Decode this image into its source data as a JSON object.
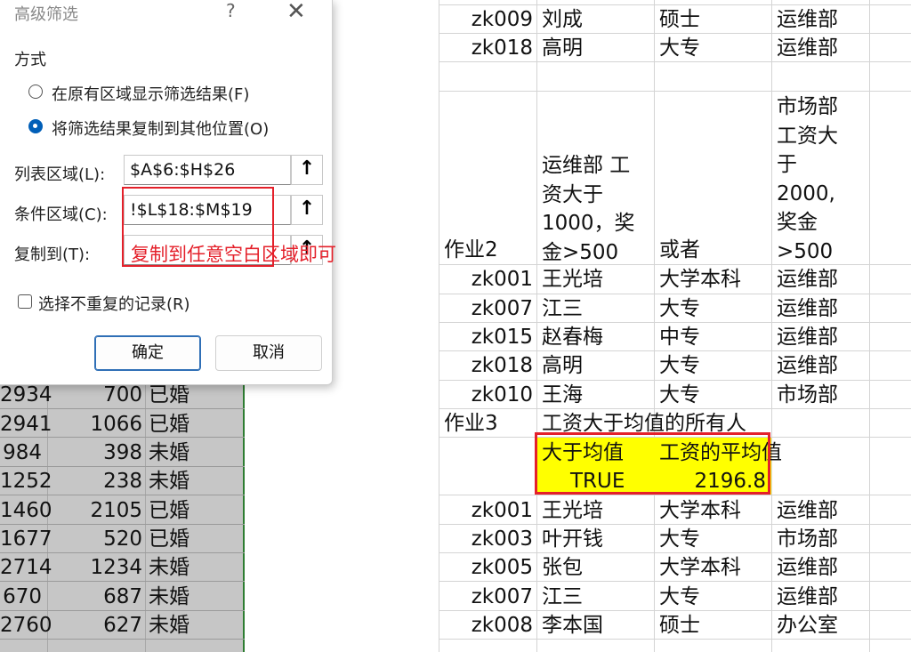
{
  "dialog": {
    "title": "高级筛选",
    "help": "?",
    "close": "✕",
    "method_label": "方式",
    "option_in_place": "在原有区域显示筛选结果(F)",
    "option_copy": "将筛选结果复制到其他位置(O)",
    "list_range_label": "列表区域(L):",
    "list_range_value": "$A$6:$H$26",
    "criteria_label": "条件区域(C):",
    "criteria_value": "!$L$18:$M$19",
    "copy_to_label": "复制到(T):",
    "copy_to_value": "",
    "unique_label": "选择不重复的记录(R)",
    "ok": "确定",
    "cancel": "取消",
    "selected_option": "copy",
    "annotation": "复制到任意空白区域即可"
  },
  "left_sheet": {
    "rows": [
      {
        "a": "2934",
        "b": "700",
        "c": "已婚"
      },
      {
        "a": "2941",
        "b": "1066",
        "c": "已婚"
      },
      {
        "a": "984",
        "b": "398",
        "c": "未婚"
      },
      {
        "a": "1252",
        "b": "238",
        "c": "未婚"
      },
      {
        "a": "1460",
        "b": "2105",
        "c": "已婚"
      },
      {
        "a": "1677",
        "b": "520",
        "c": "已婚"
      },
      {
        "a": "2714",
        "b": "1234",
        "c": "未婚"
      },
      {
        "a": "670",
        "b": "687",
        "c": "未婚"
      },
      {
        "a": "2760",
        "b": "627",
        "c": "未婚"
      }
    ]
  },
  "sheet": {
    "top_rows": [
      {
        "id": "zk009",
        "name": "刘成",
        "edu": "硕士",
        "dept": "运维部"
      },
      {
        "id": "zk018",
        "name": "高明",
        "edu": "大专",
        "dept": "运维部"
      }
    ],
    "hw2_label": "作业2",
    "hw2_criteria": "运维部 工\n资大于\n1000，奖\n金>500",
    "hw2_or": "或者",
    "hw2_right": "市场部\n工资大\n于\n2000,\n奖金\n>500",
    "hw2_rows": [
      {
        "id": "zk001",
        "name": "王光培",
        "edu": "大学本科",
        "dept": "运维部"
      },
      {
        "id": "zk007",
        "name": "江三",
        "edu": "大专",
        "dept": "运维部"
      },
      {
        "id": "zk015",
        "name": "赵春梅",
        "edu": "中专",
        "dept": "运维部"
      },
      {
        "id": "zk018",
        "name": "高明",
        "edu": "大专",
        "dept": "运维部"
      },
      {
        "id": "zk010",
        "name": "王海",
        "edu": "大专",
        "dept": "市场部"
      }
    ],
    "hw3_label": "作业3",
    "hw3_title": "工资大于均值的所有人",
    "hw3_crit_header1": "大于均值",
    "hw3_crit_header2": "工资的平均值",
    "hw3_crit_value1": "TRUE",
    "hw3_crit_value2": "2196.8",
    "hw3_rows": [
      {
        "id": "zk001",
        "name": "王光培",
        "edu": "大学本科",
        "dept": "运维部"
      },
      {
        "id": "zk003",
        "name": "叶开钱",
        "edu": "大专",
        "dept": "市场部"
      },
      {
        "id": "zk005",
        "name": "张包",
        "edu": "大学本科",
        "dept": "运维部"
      },
      {
        "id": "zk007",
        "name": "江三",
        "edu": "大专",
        "dept": "运维部"
      },
      {
        "id": "zk008",
        "name": "李本国",
        "edu": "硕士",
        "dept": "办公室"
      }
    ]
  },
  "colors": {
    "highlight_yellow": "#ffff00",
    "annotation_red": "#e4202a",
    "accent_blue": "#005fb8",
    "selection_gray": "#c6c6c6"
  }
}
